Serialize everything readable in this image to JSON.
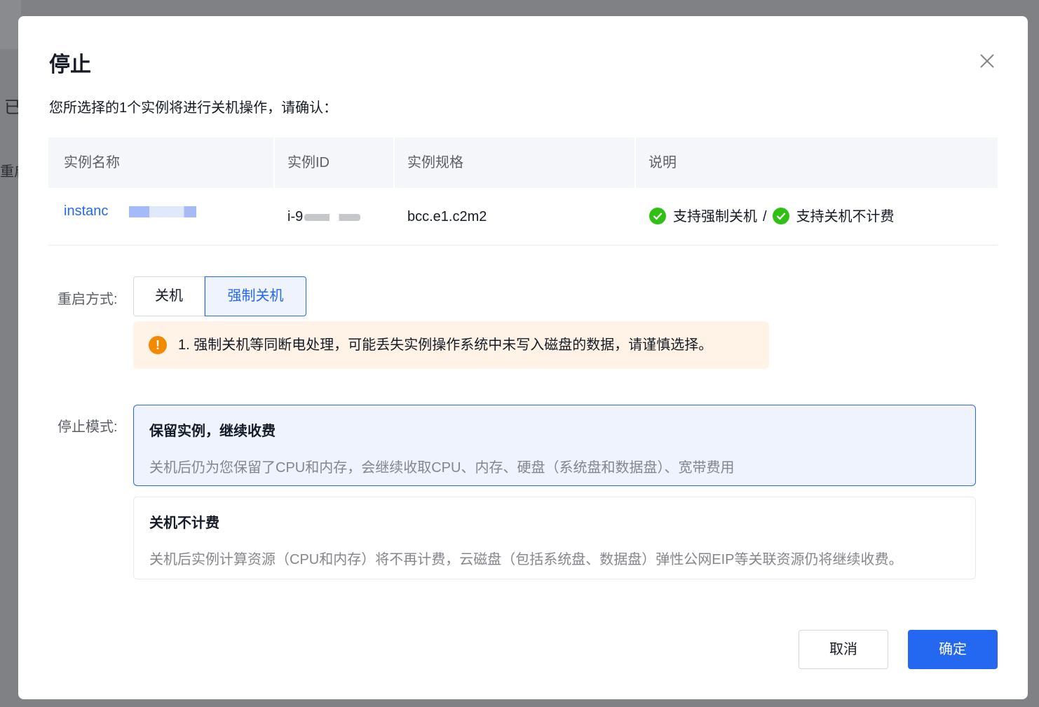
{
  "background": {
    "fragment_1": "已",
    "fragment_2": "重启"
  },
  "dialog": {
    "title": "停止",
    "close_icon": "close-icon",
    "intro": "您所选择的1个实例将进行关机操作，请确认："
  },
  "table": {
    "headers": [
      "实例名称",
      "实例ID",
      "实例规格",
      "说明"
    ],
    "rows": [
      {
        "name": "instanc",
        "id": "i-9",
        "spec": "bcc.e1.c2m2",
        "note_1": "支持强制关机",
        "note_sep": "/",
        "note_2": "支持关机不计费"
      }
    ]
  },
  "restart_mode": {
    "label": "重启方式:",
    "options": [
      "关机",
      "强制关机"
    ],
    "selected": "强制关机"
  },
  "warning": {
    "icon": "!",
    "text": "1. 强制关机等同断电处理，可能丢失实例操作系统中未写入磁盘的数据，请谨慎选择。"
  },
  "stop_mode": {
    "label": "停止模式:",
    "options": [
      {
        "title": "保留实例，继续收费",
        "desc": "关机后仍为您保留了CPU和内存，会继续收取CPU、内存、硬盘（系统盘和数据盘）、宽带费用",
        "selected": true
      },
      {
        "title": "关机不计费",
        "desc": "关机后实例计算资源（CPU和内存）将不再计费，云磁盘（包括系统盘、数据盘）弹性公网EIP等关联资源仍将继续收费。",
        "selected": false
      }
    ]
  },
  "footer": {
    "cancel": "取消",
    "ok": "确定"
  },
  "colors": {
    "primary": "#2468f2",
    "success": "#30bf13",
    "warning": "#f38900",
    "warning_bg": "#fef3e6",
    "selected_bg": "#eef3fe"
  }
}
